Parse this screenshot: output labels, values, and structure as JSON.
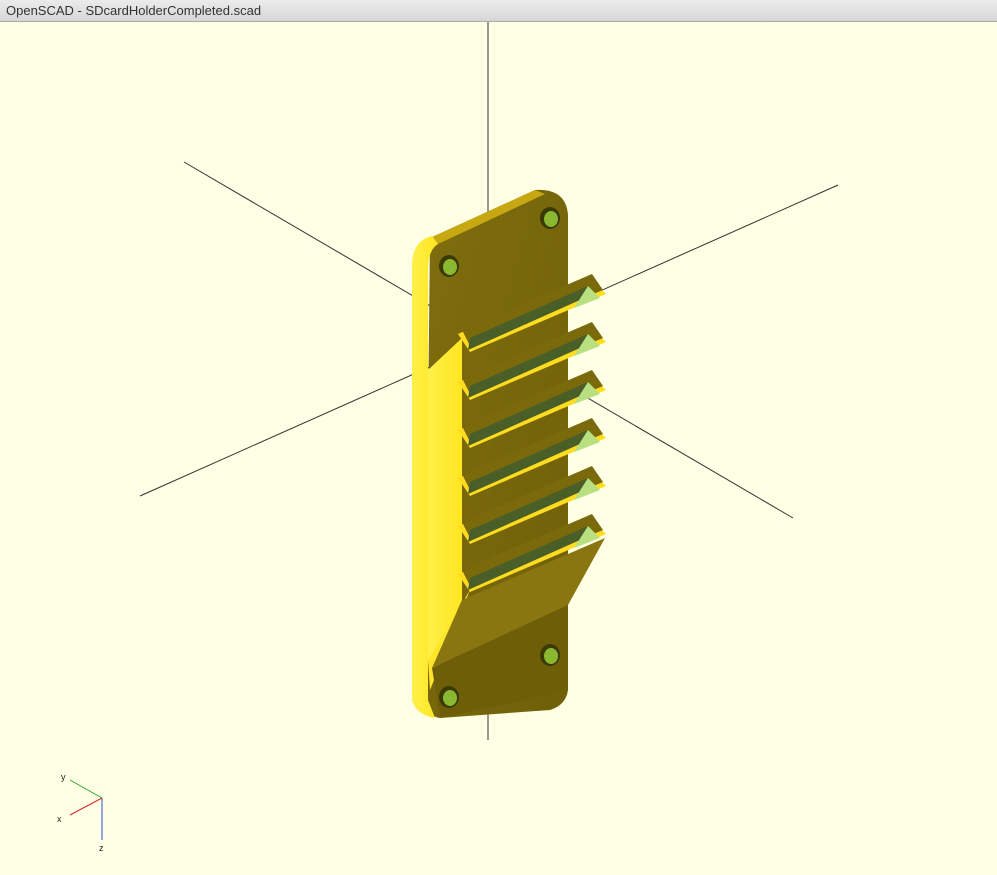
{
  "window": {
    "title": "OpenSCAD - SDcardHolderCompleted.scad"
  },
  "scene": {
    "background_color": "#ffffe5",
    "model_colors": {
      "front_face": "#ffee33",
      "top_face": "#7a6a0c",
      "slot_inner": "#4a5e28",
      "slot_side": "#b8e080",
      "hole": "#5c6a10"
    },
    "slot_count": 6,
    "hole_count": 4
  },
  "axes_gizmo": {
    "x_label": "x",
    "y_label": "y",
    "z_label": "z"
  }
}
